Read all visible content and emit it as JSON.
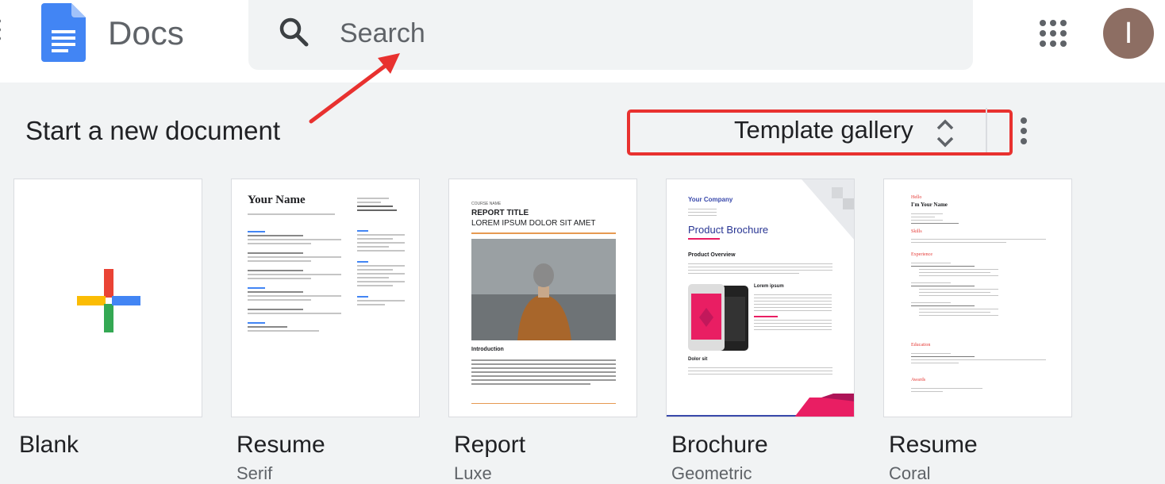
{
  "app": {
    "title": "Docs"
  },
  "search": {
    "placeholder": "Search"
  },
  "user": {
    "avatar_initial": "I",
    "avatar_color": "#8d6e63"
  },
  "section": {
    "title": "Start a new document"
  },
  "template_gallery": {
    "label": "Template gallery"
  },
  "annotations": {
    "arrow_color": "#e8312f",
    "highlight_color": "#e8312f"
  },
  "templates": [
    {
      "label": "Blank",
      "sub": ""
    },
    {
      "label": "Resume",
      "sub": "Serif"
    },
    {
      "label": "Report",
      "sub": "Luxe"
    },
    {
      "label": "Brochure",
      "sub": "Geometric"
    },
    {
      "label": "Resume",
      "sub": "Coral"
    }
  ],
  "previews": {
    "resume1": {
      "name": "Your Name"
    },
    "report": {
      "course": "COURSE NAME",
      "title1": "REPORT TITLE",
      "title2": "LOREM IPSUM DOLOR SIT AMET",
      "intro": "Introduction"
    },
    "brochure": {
      "company": "Your Company",
      "title": "Product Brochure",
      "section": "Product Overview",
      "lorem": "Lorem ipsum",
      "dolor": "Dolor sit"
    },
    "resume2": {
      "hello": "Hello",
      "name": "I'm Your Name",
      "skills": "Skills",
      "experience": "Experience",
      "education": "Education",
      "awards": "Awards"
    }
  }
}
